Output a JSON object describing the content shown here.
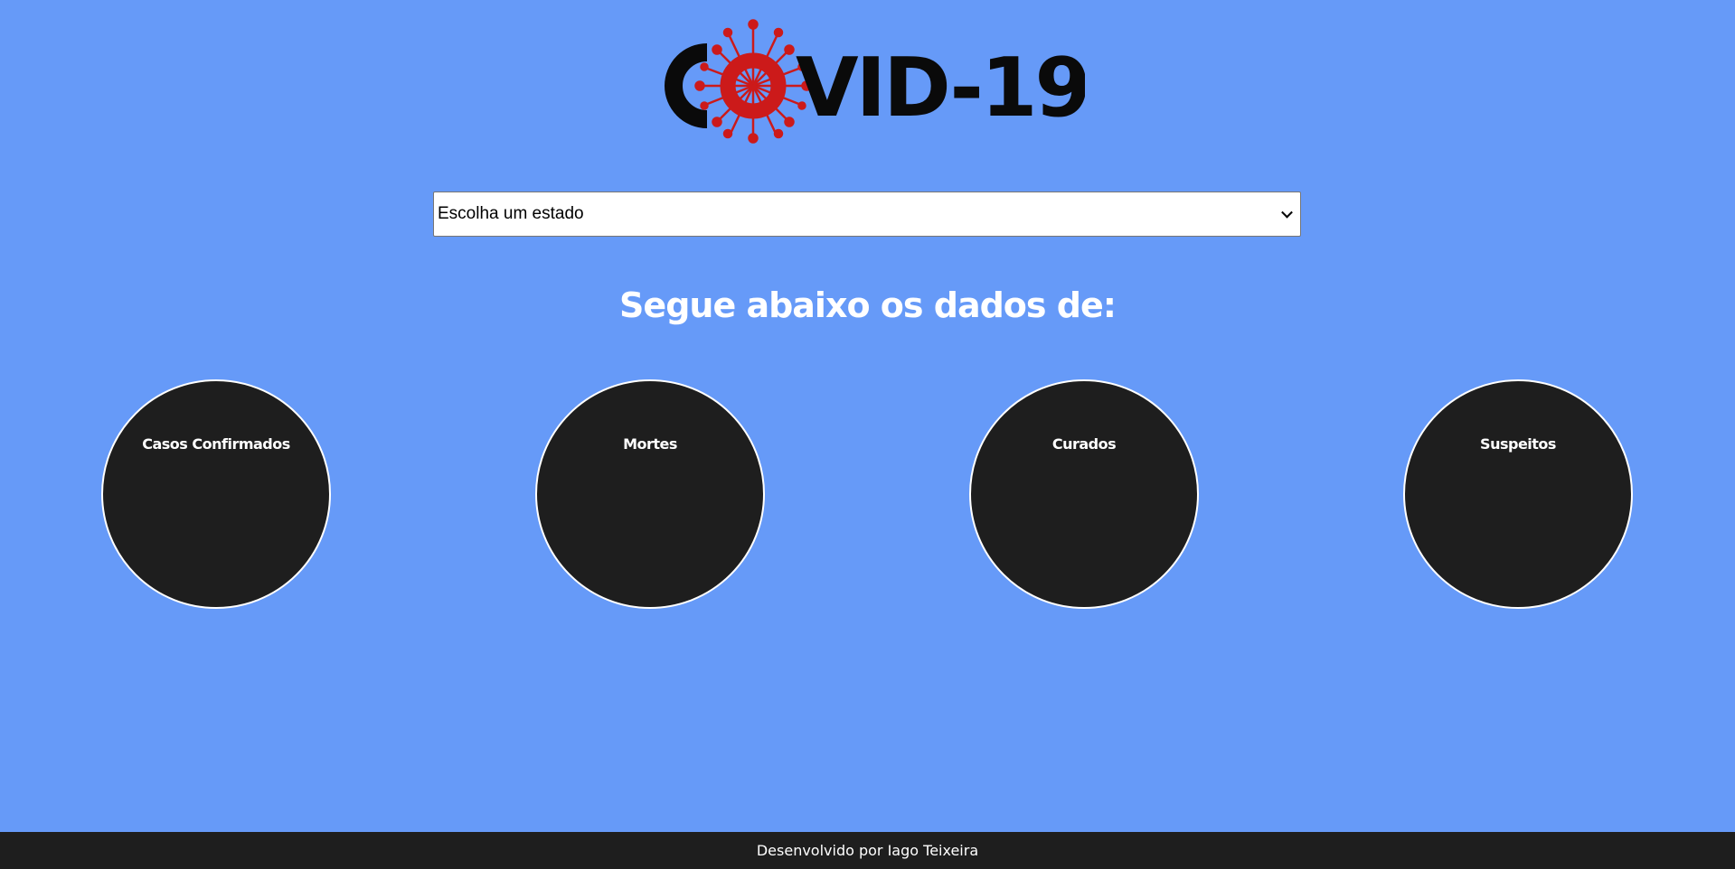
{
  "header": {
    "logo_text": "COVID-19",
    "logo_colors": {
      "text": "#0a0a0a",
      "virus": "#cc1a1a"
    }
  },
  "state_select": {
    "selected": "Escolha um estado",
    "icon": "chevron-down-icon"
  },
  "heading": "Segue abaixo os dados de:",
  "stats": [
    {
      "label": "Casos Confirmados",
      "value": ""
    },
    {
      "label": "Mortes",
      "value": ""
    },
    {
      "label": "Curados",
      "value": ""
    },
    {
      "label": "Suspeitos",
      "value": ""
    }
  ],
  "footer": {
    "text": "Desenvolvido por Iago Teixeira"
  },
  "colors": {
    "background": "#669af8",
    "circle": "#1e1e1e",
    "footer": "#1e1e1e"
  }
}
